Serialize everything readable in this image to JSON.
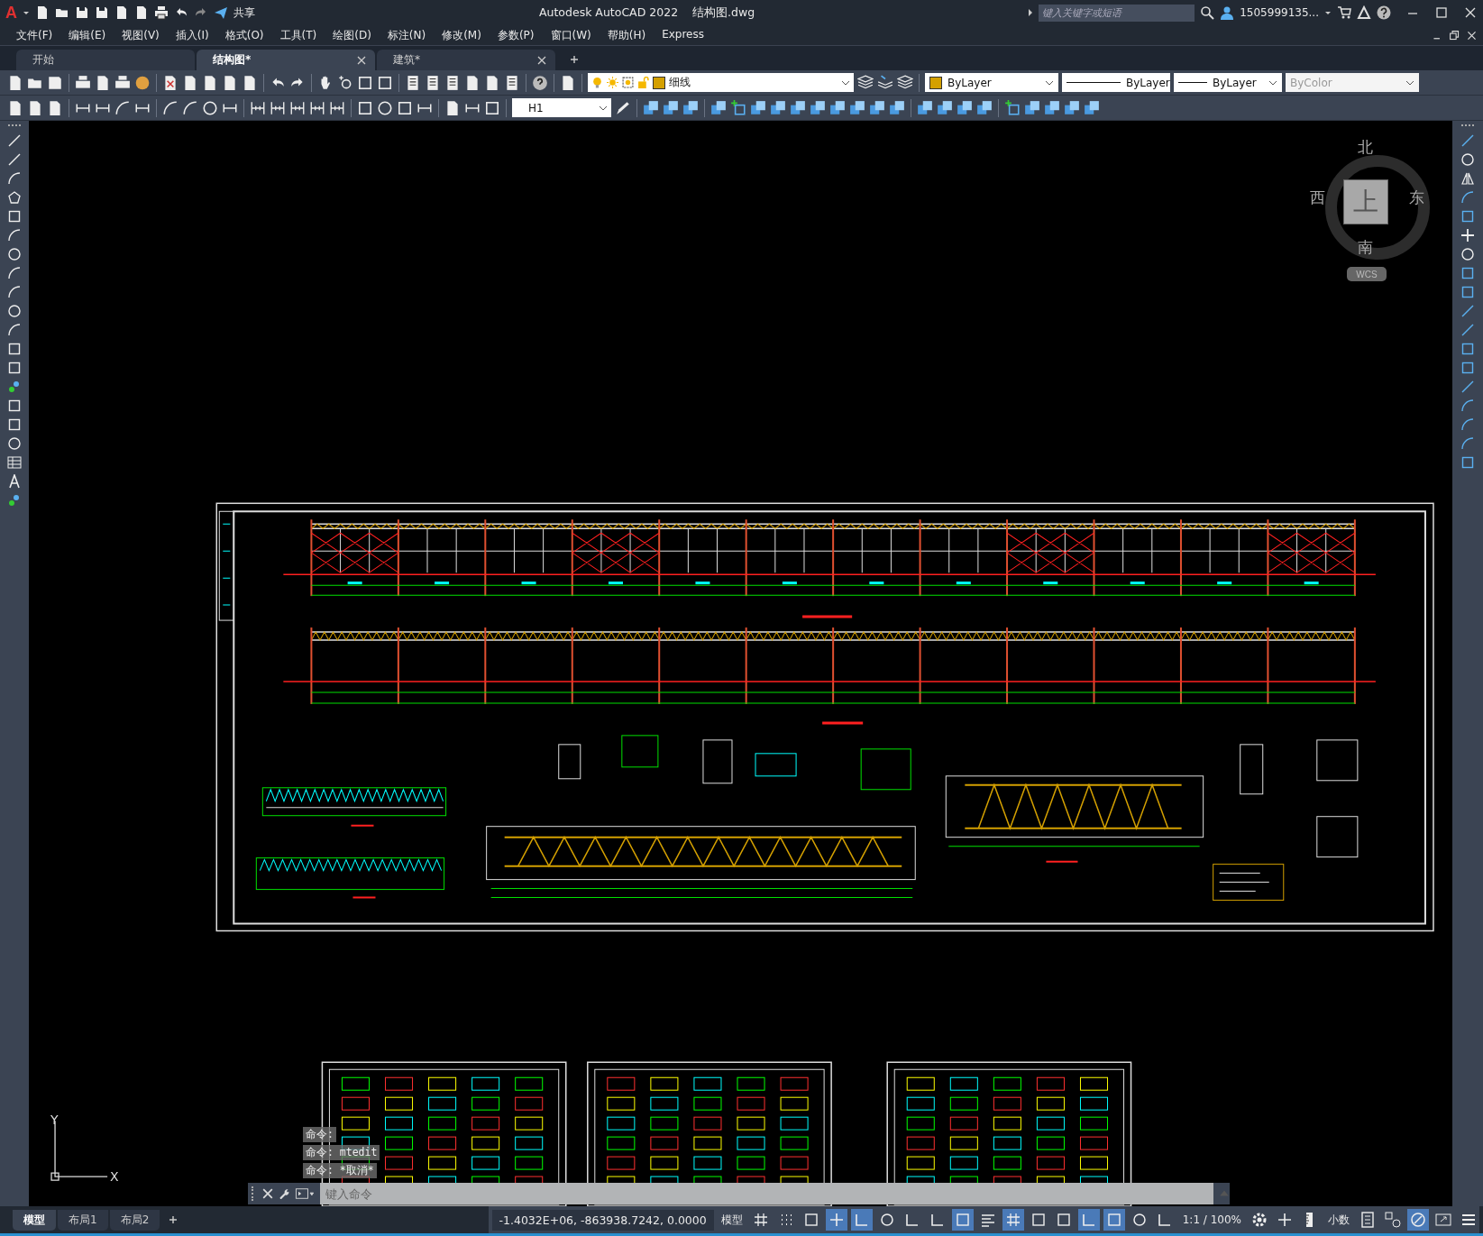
{
  "app_button": {
    "logo": "A"
  },
  "quick_access": {
    "share_label": "共享"
  },
  "window": {
    "title": "Autodesk AutoCAD 2022",
    "filename": "结构图.dwg"
  },
  "search": {
    "placeholder": "键入关键字或短语"
  },
  "user": {
    "name": "1505999135..."
  },
  "menu": [
    "文件(F)",
    "编辑(E)",
    "视图(V)",
    "插入(I)",
    "格式(O)",
    "工具(T)",
    "绘图(D)",
    "标注(N)",
    "修改(M)",
    "参数(P)",
    "窗口(W)",
    "帮助(H)",
    "Express"
  ],
  "tabs": [
    {
      "label": "开始",
      "selected": false,
      "closable": false
    },
    {
      "label": "结构图*",
      "selected": true,
      "closable": true
    },
    {
      "label": "建筑*",
      "selected": false,
      "closable": true
    }
  ],
  "layer": {
    "name": "细线",
    "color": "#d4a000"
  },
  "properties": [
    {
      "kind": "color",
      "label": "ByLayer",
      "color": "#d4a000",
      "disabled": false
    },
    {
      "kind": "linetype",
      "label": "ByLayer",
      "disabled": false
    },
    {
      "kind": "lineweight",
      "label": "ByLayer",
      "disabled": false
    },
    {
      "kind": "plotstyle",
      "label": "ByColor",
      "disabled": true
    }
  ],
  "dim_style": "H1",
  "viewcube": {
    "north": "北",
    "south": "南",
    "west": "西",
    "east": "东",
    "face": "上",
    "wcs": "WCS"
  },
  "ucs": {
    "x": "X",
    "y": "Y"
  },
  "command_history": [
    "命令:",
    "命令: mtedit",
    "命令: *取消*"
  ],
  "command_input": {
    "placeholder": "键入命令"
  },
  "layout_tabs": [
    {
      "label": "模型",
      "selected": true
    },
    {
      "label": "布局1",
      "selected": false
    },
    {
      "label": "布局2",
      "selected": false
    }
  ],
  "status": {
    "coordinates": "-1.4032E+06, -863938.7242, 0.0000",
    "space": "模型",
    "scale": "1:1 / 100%",
    "units": "小数"
  },
  "status_toggles": [
    {
      "on": false
    },
    {
      "on": false
    },
    {
      "on": false
    },
    {
      "on": true
    },
    {
      "on": true
    },
    {
      "on": false
    },
    {
      "on": false
    },
    {
      "on": false
    },
    {
      "on": true
    },
    {
      "on": false
    },
    {
      "on": true
    },
    {
      "on": false
    },
    {
      "on": false
    },
    {
      "on": true
    },
    {
      "on": true
    },
    {
      "on": false
    },
    {
      "on": false
    }
  ]
}
